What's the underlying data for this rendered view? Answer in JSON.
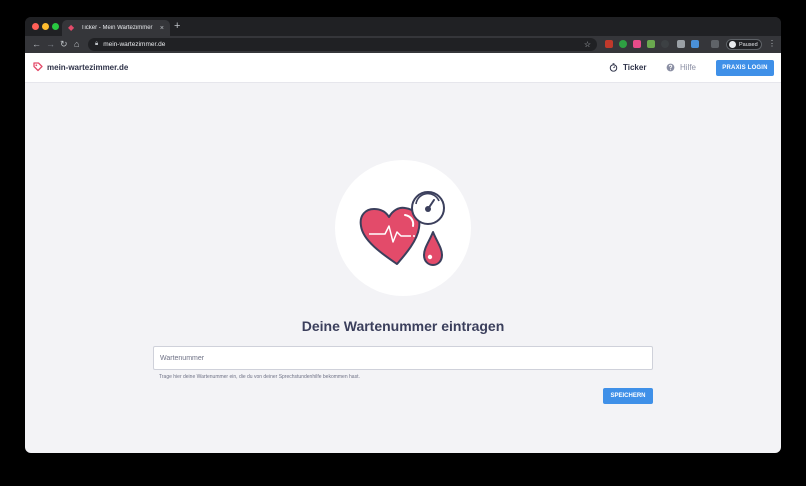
{
  "browser": {
    "tab_title": "Ticker - Mein Wartezimmer",
    "tab_close": "×",
    "new_tab": "+",
    "url": "mein-wartezimmer.de",
    "profile_status": "Paused"
  },
  "navbar": {
    "brand": "mein-wartezimmer.de",
    "ticker_label": "Ticker",
    "hilfe_label": "Hilfe",
    "login_label": "PRAXIS LOGIN"
  },
  "main": {
    "heading": "Deine Wartenummer eintragen",
    "input_placeholder": "Wartenummer",
    "hint": "Trage hier deine Wartenummer ein, die du von deiner Sprechstundenhilfe bekommen hast.",
    "save_label": "SPEICHERN"
  },
  "colors": {
    "accent": "#3f90e8",
    "heart": "#e34b6a",
    "text_dark": "#3b3f5c"
  }
}
